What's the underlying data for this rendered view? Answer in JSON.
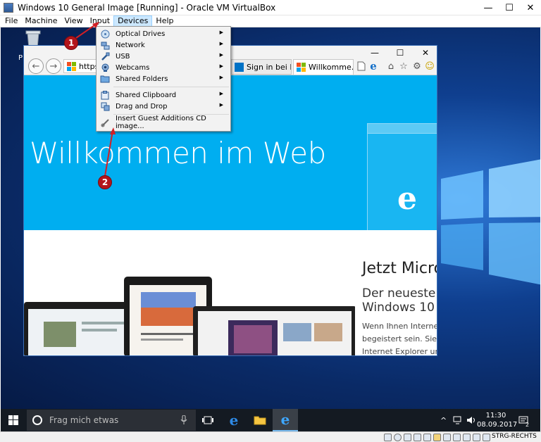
{
  "window": {
    "title": "Windows 10 General Image [Running] - Oracle VM VirtualBox",
    "controls": {
      "minimize": "—",
      "maximize": "☐",
      "close": "✕"
    }
  },
  "menubar": {
    "items": [
      "File",
      "Machine",
      "View",
      "Input",
      "Devices",
      "Help"
    ],
    "active": "Devices"
  },
  "devices_menu": {
    "items": [
      {
        "label": "Optical Drives",
        "icon": "optical-drive-icon",
        "submenu": true
      },
      {
        "label": "Network",
        "icon": "network-icon",
        "submenu": true
      },
      {
        "label": "USB",
        "icon": "usb-icon",
        "submenu": true
      },
      {
        "label": "Webcams",
        "icon": "webcam-icon",
        "submenu": true
      },
      {
        "label": "Shared Folders",
        "icon": "shared-folder-icon",
        "submenu": true
      },
      {
        "label": "Shared Clipboard",
        "icon": "clipboard-icon",
        "submenu": true
      },
      {
        "label": "Drag and Drop",
        "icon": "drag-drop-icon",
        "submenu": true
      },
      {
        "label": "Insert Guest Additions CD image...",
        "icon": "guest-additions-icon",
        "submenu": false
      }
    ],
    "arrow": "▶"
  },
  "callouts": [
    "1",
    "2"
  ],
  "desktop": {
    "recycle_label": "P"
  },
  "browser": {
    "address": "https://",
    "tabs": [
      {
        "label": "Sign in bei Hot…",
        "active": false
      },
      {
        "label": "Willkomme…",
        "active": true
      }
    ],
    "tab_close": "✕",
    "controls": {
      "minimize": "—",
      "maximize": "☐",
      "close": "✕"
    },
    "nav": {
      "back": "←",
      "forward": "→"
    },
    "toolbar_glyphs": {
      "home": "⌂",
      "favorites": "☆",
      "settings": "⚙",
      "smiley": "☺"
    },
    "page": {
      "hero_title": "Willkommen im Web",
      "heading": "Jetzt Micro",
      "subheading_1": "Der neueste B",
      "subheading_2": "Windows 10",
      "body_1": "Wenn Ihnen Internet",
      "body_2": "begeistert sein. Sie p",
      "body_3": "Internet Explorer und"
    }
  },
  "taskbar": {
    "search_placeholder": "Frag mich etwas",
    "clock_time": "11:30",
    "clock_date": "08.09.2017",
    "notification_count": "2"
  },
  "statusbar": {
    "host_key": "STRG-RECHTS"
  },
  "colors": {
    "hero_blue": "#00aef0",
    "menu_highlight": "#cce8ff",
    "callout_red": "#b3151b",
    "taskbar": "#141a22"
  }
}
